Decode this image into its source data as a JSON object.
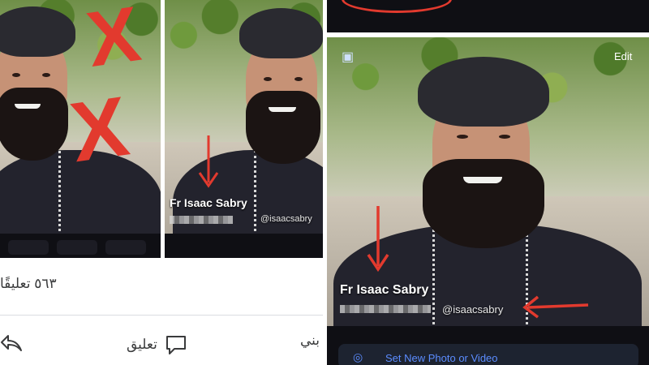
{
  "panels": {
    "left_photo": {
      "marks": [
        "X",
        "X"
      ]
    },
    "middle_photo": {
      "overlay_name": "Fr Isaac Sabry",
      "overlay_handle": "@isaacsabry"
    },
    "right_photo": {
      "edit_label": "Edit",
      "overlay_name": "Fr Isaac Sabry",
      "overlay_handle": "@isaacsabry",
      "footer_label": "Set New Photo or Video"
    }
  },
  "facebook_post": {
    "comments_count": "٥٦٣ تعليقًا",
    "comment_action": "تعليق",
    "partial_action": "بني"
  },
  "colors": {
    "arrow": "#e23a2e",
    "robe": "#23232d",
    "dark_bar": "#0f0f14"
  },
  "icons": [
    "comment-icon",
    "share-icon",
    "camera-icon",
    "arrow-icon",
    "x-mark"
  ]
}
